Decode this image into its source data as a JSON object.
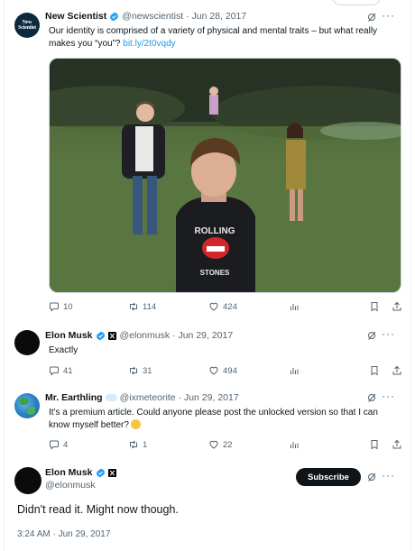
{
  "tweets": [
    {
      "display_name": "New Scientist",
      "handle": "@newscientist",
      "date": "Jun 28, 2017",
      "avatar_text": [
        "New",
        "Scientist"
      ],
      "text": "Our identity is comprised of a variety of physical and mental traits – but what really makes you “you”? ",
      "link": "bit.ly/2t0vqdy",
      "replies": "10",
      "retweets": "114",
      "likes": "424",
      "image_shirt_text": [
        "ROLLING",
        "STONES"
      ]
    },
    {
      "display_name": "Elon Musk",
      "handle": "@elonmusk",
      "date": "Jun 29, 2017",
      "text": "Exactly",
      "replies": "41",
      "retweets": "31",
      "likes": "494"
    },
    {
      "display_name": "Mr. Earthling",
      "handle": "@ixmeteorite",
      "date": "Jun 29, 2017",
      "text": "It's a premium article. Could anyone please post the unlocked version so that I can know myself better?",
      "replies": "4",
      "retweets": "1",
      "likes": "22"
    }
  ],
  "main_tweet": {
    "display_name": "Elon Musk",
    "handle": "@elonmusk",
    "subscribe_label": "Subscribe",
    "text": "Didn't read it. Might now though.",
    "timestamp": "3:24 AM · Jun 29, 2017"
  },
  "icons": {
    "verified": "verified-badge-icon",
    "grok": "grok-icon",
    "more": "more-icon",
    "reply": "reply-icon",
    "retweet": "retweet-icon",
    "like": "heart-icon",
    "views": "views-icon",
    "bookmark": "bookmark-icon",
    "share": "share-icon"
  },
  "colors": {
    "accent": "#1d9bf0",
    "text": "#0f1419",
    "muted": "#536471",
    "border": "#eff3f4"
  }
}
